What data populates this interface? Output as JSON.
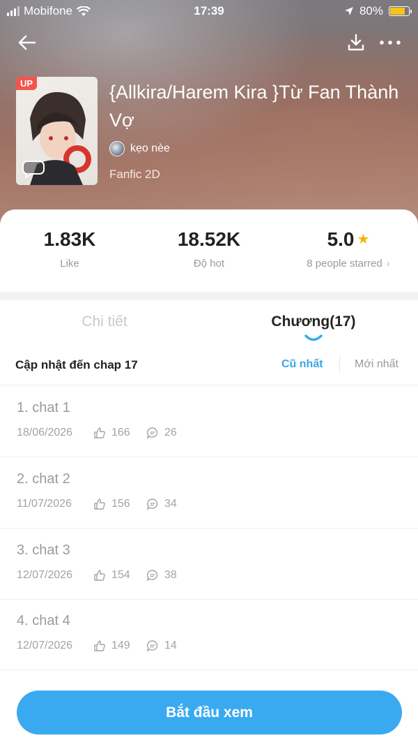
{
  "status_bar": {
    "carrier": "Mobifone",
    "time": "17:39",
    "battery": "80%",
    "battery_level": 0.8
  },
  "header": {
    "back_icon": "arrow-left-icon",
    "download_icon": "download-icon",
    "more_icon": "more-dots-icon"
  },
  "book": {
    "badge": "UP",
    "title": "{Allkira/Harem Kira }Từ Fan Thành Vợ",
    "author": "kẹo nèe",
    "genre": "Fanfic 2D"
  },
  "stats": {
    "likes": "1.83K",
    "likes_label": "Like",
    "hot": "18.52K",
    "hot_label": "Độ hot",
    "rating": "5.0",
    "rating_label": "8 people starred"
  },
  "tabs": {
    "detail": "Chi tiết",
    "chapters": "Chương(17)"
  },
  "sort": {
    "title": "Cập nhật đến chap 17",
    "oldest": "Cũ nhất",
    "newest": "Mới nhất"
  },
  "chapters": [
    {
      "title": "1. chat 1",
      "date": "18/06/2026",
      "likes": "166",
      "comments": "26"
    },
    {
      "title": "2. chat 2",
      "date": "11/07/2026",
      "likes": "156",
      "comments": "34"
    },
    {
      "title": "3. chat 3",
      "date": "12/07/2026",
      "likes": "154",
      "comments": "38"
    },
    {
      "title": "4. chat 4",
      "date": "12/07/2026",
      "likes": "149",
      "comments": "14"
    }
  ],
  "start_button": "Bắt đầu xem",
  "colors": {
    "accent": "#3aaaf0",
    "badge": "#f2554c",
    "star": "#f5b400"
  }
}
